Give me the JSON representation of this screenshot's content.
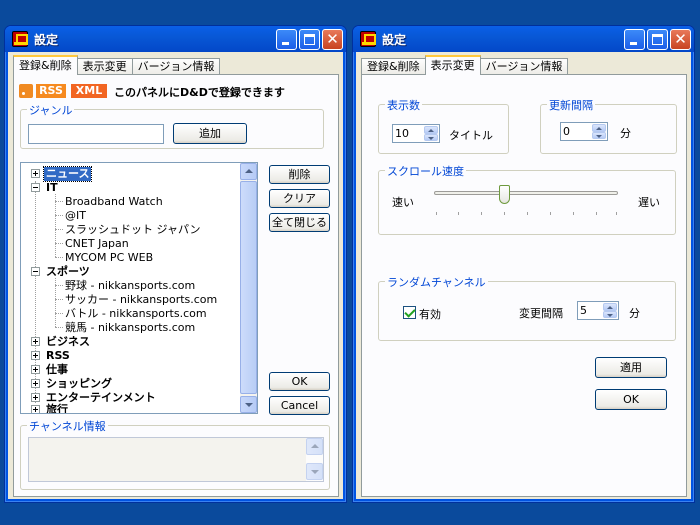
{
  "left_window": {
    "title": "設定",
    "tabs": [
      {
        "label": "登録&削除",
        "active": true
      },
      {
        "label": "表示変更",
        "active": false
      },
      {
        "label": "バージョン情報",
        "active": false
      }
    ],
    "badges": {
      "rss": "RSS",
      "xml": "XML"
    },
    "drop_hint": "このパネルにD&Dで登録できます",
    "genre_group": "ジャンル",
    "genre_input_value": "",
    "add_button": "追加",
    "tree": {
      "n0": "ニュース",
      "n1": "IT",
      "n1c0": "Broadband Watch",
      "n1c1": "@IT",
      "n1c2": "スラッシュドット ジャパン",
      "n1c3": "CNET Japan",
      "n1c4": "MYCOM PC WEB",
      "n2": "スポーツ",
      "n2c0": "野球 - nikkansports.com",
      "n2c1": "サッカー - nikkansports.com",
      "n2c2": "バトル - nikkansports.com",
      "n2c3": "競馬 - nikkansports.com",
      "n3": "ビジネス",
      "n4": "RSS",
      "n5": "仕事",
      "n6": "ショッピング",
      "n7": "エンターテインメント",
      "n8": "旅行"
    },
    "buttons": {
      "delete": "削除",
      "clear": "クリア",
      "collapse_all": "全て閉じる",
      "ok": "OK",
      "cancel": "Cancel"
    },
    "channel_info_group": "チャンネル情報"
  },
  "right_window": {
    "title": "設定",
    "tabs": [
      {
        "label": "登録&削除",
        "active": false
      },
      {
        "label": "表示変更",
        "active": true
      },
      {
        "label": "バージョン情報",
        "active": false
      }
    ],
    "display_count_group": "表示数",
    "display_count_value": "10",
    "display_count_unit": "タイトル",
    "update_interval_group": "更新間隔",
    "update_interval_value": "0",
    "update_interval_unit": "分",
    "scroll_speed_group": "スクロール速度",
    "scroll_fast": "速い",
    "scroll_slow": "遅い",
    "scroll_speed_level": 0.375,
    "random_group": "ランダムチャンネル",
    "enabled_label": "有効",
    "enabled_checked": true,
    "change_interval_label": "変更間隔",
    "change_interval_value": "5",
    "change_interval_unit": "分",
    "apply_button": "適用",
    "ok_button": "OK"
  }
}
